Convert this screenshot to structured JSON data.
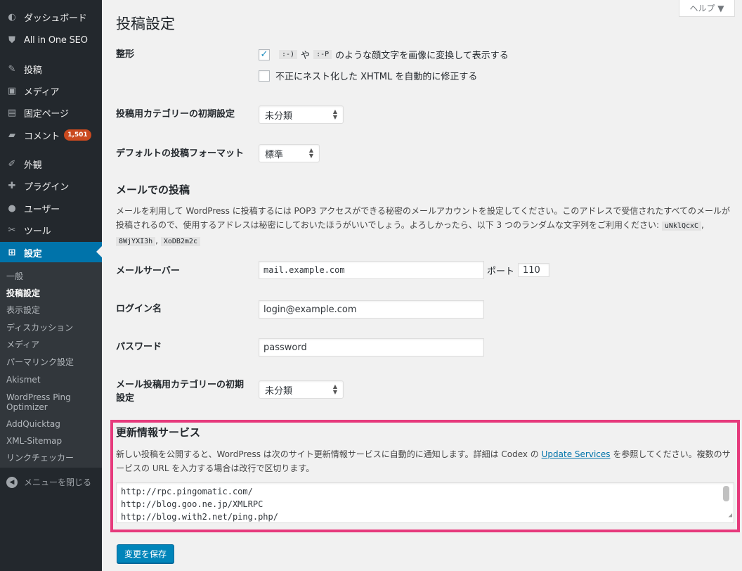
{
  "sidebar": {
    "items": [
      {
        "label": "ダッシュボード",
        "icon": "dashboard-icon"
      },
      {
        "label": "All in One SEO",
        "icon": "shield-icon"
      },
      {
        "label": "投稿",
        "icon": "pin-icon"
      },
      {
        "label": "メディア",
        "icon": "media-icon"
      },
      {
        "label": "固定ページ",
        "icon": "page-icon"
      },
      {
        "label": "コメント",
        "icon": "comment-icon",
        "badge": "1,501"
      },
      {
        "label": "外観",
        "icon": "brush-icon"
      },
      {
        "label": "プラグイン",
        "icon": "plugin-icon"
      },
      {
        "label": "ユーザー",
        "icon": "user-icon"
      },
      {
        "label": "ツール",
        "icon": "wrench-icon"
      },
      {
        "label": "設定",
        "icon": "settings-icon",
        "current": true
      }
    ],
    "submenu": [
      "一般",
      "投稿設定",
      "表示設定",
      "ディスカッション",
      "メディア",
      "パーマリンク設定",
      "Akismet",
      "WordPress Ping Optimizer",
      "AddQuicktag",
      "XML-Sitemap",
      "リンクチェッカー"
    ],
    "collapse_label": "メニューを閉じる"
  },
  "help_tab": "ヘルプ ▼",
  "page_title": "投稿設定",
  "formatting": {
    "label": "整形",
    "opt1_pre": "",
    "opt1_code1": ":-)",
    "opt1_mid": "や",
    "opt1_code2": ":-P",
    "opt1_post": "のような顔文字を画像に変換して表示する",
    "opt1_checked": true,
    "opt2": "不正にネスト化した XHTML を自動的に修正する",
    "opt2_checked": false
  },
  "default_category": {
    "label": "投稿用カテゴリーの初期設定",
    "value": "未分類"
  },
  "default_format": {
    "label": "デフォルトの投稿フォーマット",
    "value": "標準"
  },
  "post_via_email": {
    "title": "メールでの投稿",
    "desc_text": "メールを利用して WordPress に投稿するには POP3 アクセスができる秘密のメールアカウントを設定してください。このアドレスで受信されたすべてのメールが投稿されるので、使用するアドレスは秘密にしておいたほうがいいでしょう。よろしかったら、以下 3 つのランダムな文字列をご利用ください:",
    "codes": [
      "uNklQcxC",
      "8WjYXI3h",
      "XoDB2m2c"
    ],
    "server_label": "メールサーバー",
    "server_value": "mail.example.com",
    "port_label": "ポート",
    "port_value": "110",
    "login_label": "ログイン名",
    "login_value": "login@example.com",
    "password_label": "パスワード",
    "password_value": "password",
    "category_label": "メール投稿用カテゴリーの初期設定",
    "category_value": "未分類"
  },
  "update_services": {
    "title": "更新情報サービス",
    "desc_pre": "新しい投稿を公開すると、WordPress は次のサイト更新情報サービスに自動的に通知します。詳細は Codex の",
    "desc_link": "Update Services",
    "desc_post": "を参照してください。複数のサービスの URL を入力する場合は改行で区切ります。",
    "urls": [
      "http://rpc.pingomatic.com/",
      "http://blog.goo.ne.jp/XMLRPC",
      "http://blog.with2.net/ping.php/"
    ]
  },
  "save_button": "変更を保存",
  "colors": {
    "accent": "#0073aa",
    "highlight": "#e63a7c",
    "sidebar": "#23282d"
  }
}
